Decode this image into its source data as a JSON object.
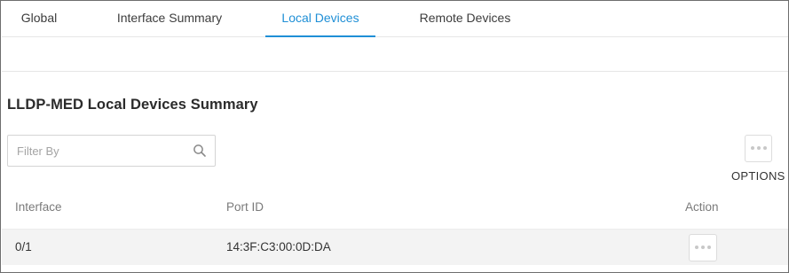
{
  "tabs": {
    "global": "Global",
    "interface_summary": "Interface Summary",
    "local_devices": "Local Devices",
    "remote_devices": "Remote Devices",
    "active": "Local Devices"
  },
  "page": {
    "title": "LLDP-MED Local Devices Summary"
  },
  "filter": {
    "placeholder": "Filter By",
    "value": "",
    "icon": "search-icon"
  },
  "options": {
    "label": "OPTIONS",
    "icon": "more-dots-icon"
  },
  "table": {
    "columns": {
      "interface": "Interface",
      "port_id": "Port ID",
      "action": "Action"
    },
    "rows": [
      {
        "interface": "0/1",
        "port_id": "14:3F:C3:00:0D:DA",
        "action_icon": "more-dots-icon"
      }
    ]
  },
  "colors": {
    "accent": "#1f8fd6",
    "row_background": "#f3f3f3",
    "border": "#d4d4d4"
  }
}
